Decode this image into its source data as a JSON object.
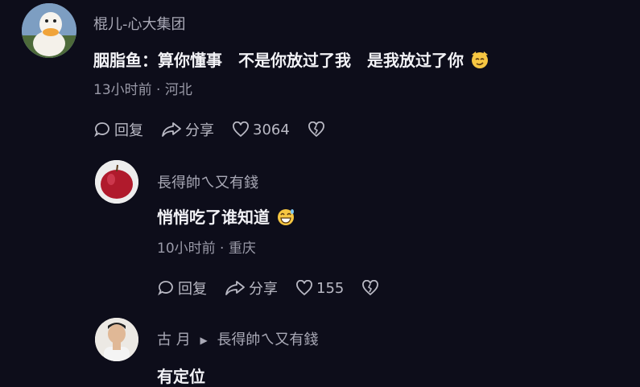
{
  "comments": [
    {
      "author": "棍儿-心大集团",
      "text": "胭脂鱼：算你懂事　不是你放过了我　是我放过了你",
      "time": "13小时前",
      "location": "河北",
      "reply_label": "回复",
      "share_label": "分享",
      "likes": "3064",
      "avatar_icon": "duck-avatar"
    },
    {
      "author": "長得帥ㄟ又有錢",
      "text": "悄悄吃了谁知道",
      "time": "10小时前",
      "location": "重庆",
      "reply_label": "回复",
      "share_label": "分享",
      "likes": "155",
      "avatar_icon": "apple-avatar"
    },
    {
      "author": "古 月",
      "reply_to": "長得帥ㄟ又有錢",
      "text": "有定位",
      "avatar_icon": "person-avatar"
    }
  ],
  "separator": "·",
  "colors": {
    "background": "#0d0d1a",
    "text": "#f2f2f6",
    "secondary": "#9a9aa8"
  }
}
